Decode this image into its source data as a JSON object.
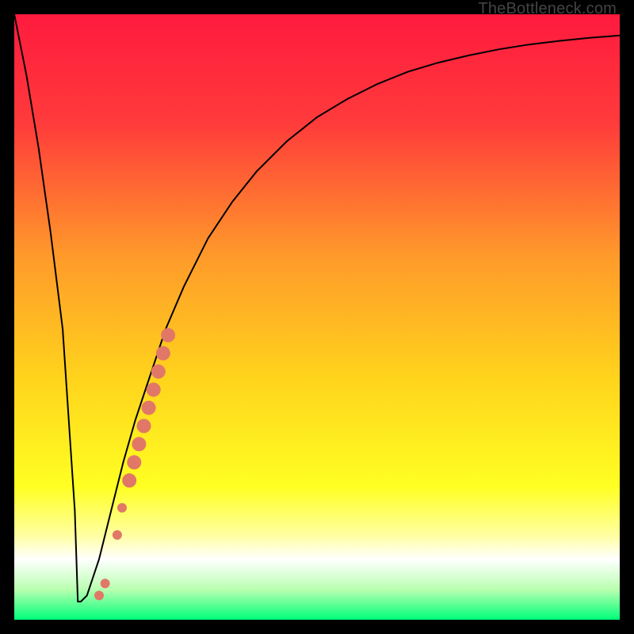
{
  "watermark": "TheBottleneck.com",
  "colors": {
    "frame": "#000000",
    "curve": "#000000",
    "markers": "#e17867",
    "gradient_stops": [
      {
        "offset": 0,
        "color": "#ff1a3e"
      },
      {
        "offset": 0.18,
        "color": "#ff3b3b"
      },
      {
        "offset": 0.4,
        "color": "#ff9a2a"
      },
      {
        "offset": 0.6,
        "color": "#ffd31c"
      },
      {
        "offset": 0.78,
        "color": "#ffff22"
      },
      {
        "offset": 0.86,
        "color": "#ffffa0"
      },
      {
        "offset": 0.9,
        "color": "#ffffff"
      },
      {
        "offset": 0.95,
        "color": "#b9ffb0"
      },
      {
        "offset": 1.0,
        "color": "#00ff7a"
      }
    ]
  },
  "chart_data": {
    "type": "line",
    "title": "",
    "xlabel": "",
    "ylabel": "",
    "xlim": [
      0,
      100
    ],
    "ylim": [
      0,
      100
    ],
    "series": [
      {
        "name": "bottleneck-curve",
        "x": [
          0,
          2,
          4,
          6,
          8,
          10,
          10.5,
          11,
          12,
          14,
          16,
          18,
          20,
          22,
          25,
          28,
          32,
          36,
          40,
          45,
          50,
          55,
          60,
          65,
          70,
          75,
          80,
          85,
          90,
          95,
          100
        ],
        "y": [
          100,
          90,
          78,
          64,
          48,
          18,
          3,
          3,
          4,
          10,
          18,
          26,
          33,
          39,
          48,
          55,
          63,
          69,
          74,
          79,
          83,
          86,
          88.5,
          90.5,
          92,
          93.2,
          94.2,
          95,
          95.6,
          96.1,
          96.5
        ]
      }
    ],
    "markers": {
      "name": "highlight-points",
      "style": "circle",
      "color": "#e17867",
      "points": [
        {
          "x": 14.0,
          "y": 4.0,
          "r": 6
        },
        {
          "x": 15.0,
          "y": 6.0,
          "r": 6
        },
        {
          "x": 17.0,
          "y": 14.0,
          "r": 6
        },
        {
          "x": 17.8,
          "y": 18.5,
          "r": 6
        },
        {
          "x": 19.0,
          "y": 23.0,
          "r": 9
        },
        {
          "x": 19.8,
          "y": 26.0,
          "r": 9
        },
        {
          "x": 20.6,
          "y": 29.0,
          "r": 9
        },
        {
          "x": 21.4,
          "y": 32.0,
          "r": 9
        },
        {
          "x": 22.2,
          "y": 35.0,
          "r": 9
        },
        {
          "x": 23.0,
          "y": 38.0,
          "r": 9
        },
        {
          "x": 23.8,
          "y": 41.0,
          "r": 9
        },
        {
          "x": 24.6,
          "y": 44.0,
          "r": 9
        },
        {
          "x": 25.4,
          "y": 47.0,
          "r": 9
        }
      ]
    }
  }
}
